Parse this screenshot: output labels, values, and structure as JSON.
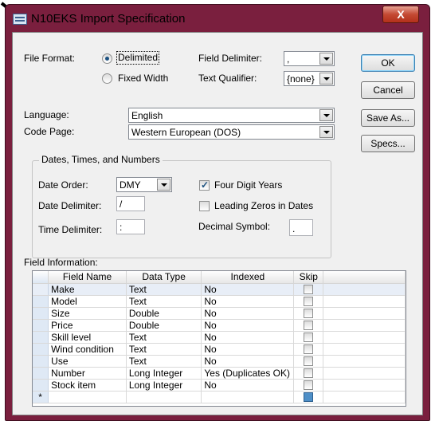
{
  "window": {
    "title": "N10EKS Import Specification",
    "close_glyph": "X"
  },
  "file_format": {
    "label": "File Format:",
    "options": [
      {
        "label": "Delimited",
        "selected": true
      },
      {
        "label": "Fixed Width",
        "selected": false
      }
    ]
  },
  "field_delimiter": {
    "label": "Field Delimiter:",
    "value": ","
  },
  "text_qualifier": {
    "label": "Text Qualifier:",
    "value": "{none}"
  },
  "buttons": {
    "ok": "OK",
    "cancel": "Cancel",
    "save_as": "Save As...",
    "specs": "Specs..."
  },
  "language": {
    "label": "Language:",
    "value": "English"
  },
  "code_page": {
    "label": "Code Page:",
    "value": "Western European (DOS)"
  },
  "dates_group": {
    "title": "Dates, Times, and Numbers",
    "date_order": {
      "label": "Date Order:",
      "value": "DMY"
    },
    "date_delimiter": {
      "label": "Date Delimiter:",
      "value": "/"
    },
    "time_delimiter": {
      "label": "Time Delimiter:",
      "value": ":"
    },
    "four_digit_years": {
      "label": "Four Digit Years",
      "checked": true
    },
    "leading_zeros": {
      "label": "Leading Zeros in Dates",
      "checked": false
    },
    "decimal_symbol": {
      "label": "Decimal Symbol:",
      "value": "."
    }
  },
  "field_info": {
    "label": "Field Information:",
    "columns": [
      "Field Name",
      "Data Type",
      "Indexed",
      "Skip"
    ],
    "rows": [
      [
        "Make",
        "Text",
        "No"
      ],
      [
        "Model",
        "Text",
        "No"
      ],
      [
        "Size",
        "Double",
        "No"
      ],
      [
        "Price",
        "Double",
        "No"
      ],
      [
        "Skill level",
        "Text",
        "No"
      ],
      [
        "Wind condition",
        "Text",
        "No"
      ],
      [
        "Use",
        "Text",
        "No"
      ],
      [
        "Number",
        "Long Integer",
        "Yes (Duplicates OK)"
      ],
      [
        "Stock item",
        "Long Integer",
        "No"
      ]
    ],
    "new_row_marker": "*"
  },
  "colors": {
    "window_frame": "#7a1f3e",
    "client_bg": "#f0f0f0",
    "close_button": "#c44a33"
  }
}
